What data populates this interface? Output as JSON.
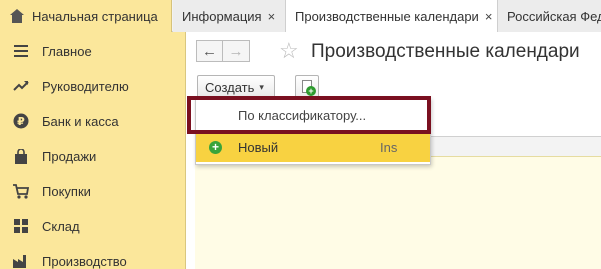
{
  "tabs": {
    "home_label": "Начальная страница",
    "items": [
      {
        "label": "Информация",
        "close": "×"
      },
      {
        "label": "Производственные календари",
        "close": "×"
      },
      {
        "label": "Российская Фед"
      }
    ]
  },
  "sidebar": {
    "items": [
      {
        "label": "Главное",
        "icon": "menu-icon"
      },
      {
        "label": "Руководителю",
        "icon": "trend-icon"
      },
      {
        "label": "Банк и касса",
        "icon": "ruble-icon"
      },
      {
        "label": "Продажи",
        "icon": "bag-icon"
      },
      {
        "label": "Покупки",
        "icon": "cart-icon"
      },
      {
        "label": "Склад",
        "icon": "warehouse-icon"
      },
      {
        "label": "Производство",
        "icon": "factory-icon"
      }
    ]
  },
  "main": {
    "back_glyph": "←",
    "forward_glyph": "→",
    "star_glyph": "☆",
    "title": "Производственные календари",
    "create_label": "Создать",
    "create_caret": "▾"
  },
  "dropdown": {
    "items": [
      {
        "label": "По классификатору..."
      },
      {
        "label": "Новый",
        "shortcut": "Ins",
        "icon": "plus-circle-icon"
      }
    ]
  },
  "colors": {
    "sidebar_bg": "#fbe79b",
    "selected_item": "#f8d241",
    "highlight_frame": "#7a1020",
    "plus_green": "#3aa43a"
  }
}
